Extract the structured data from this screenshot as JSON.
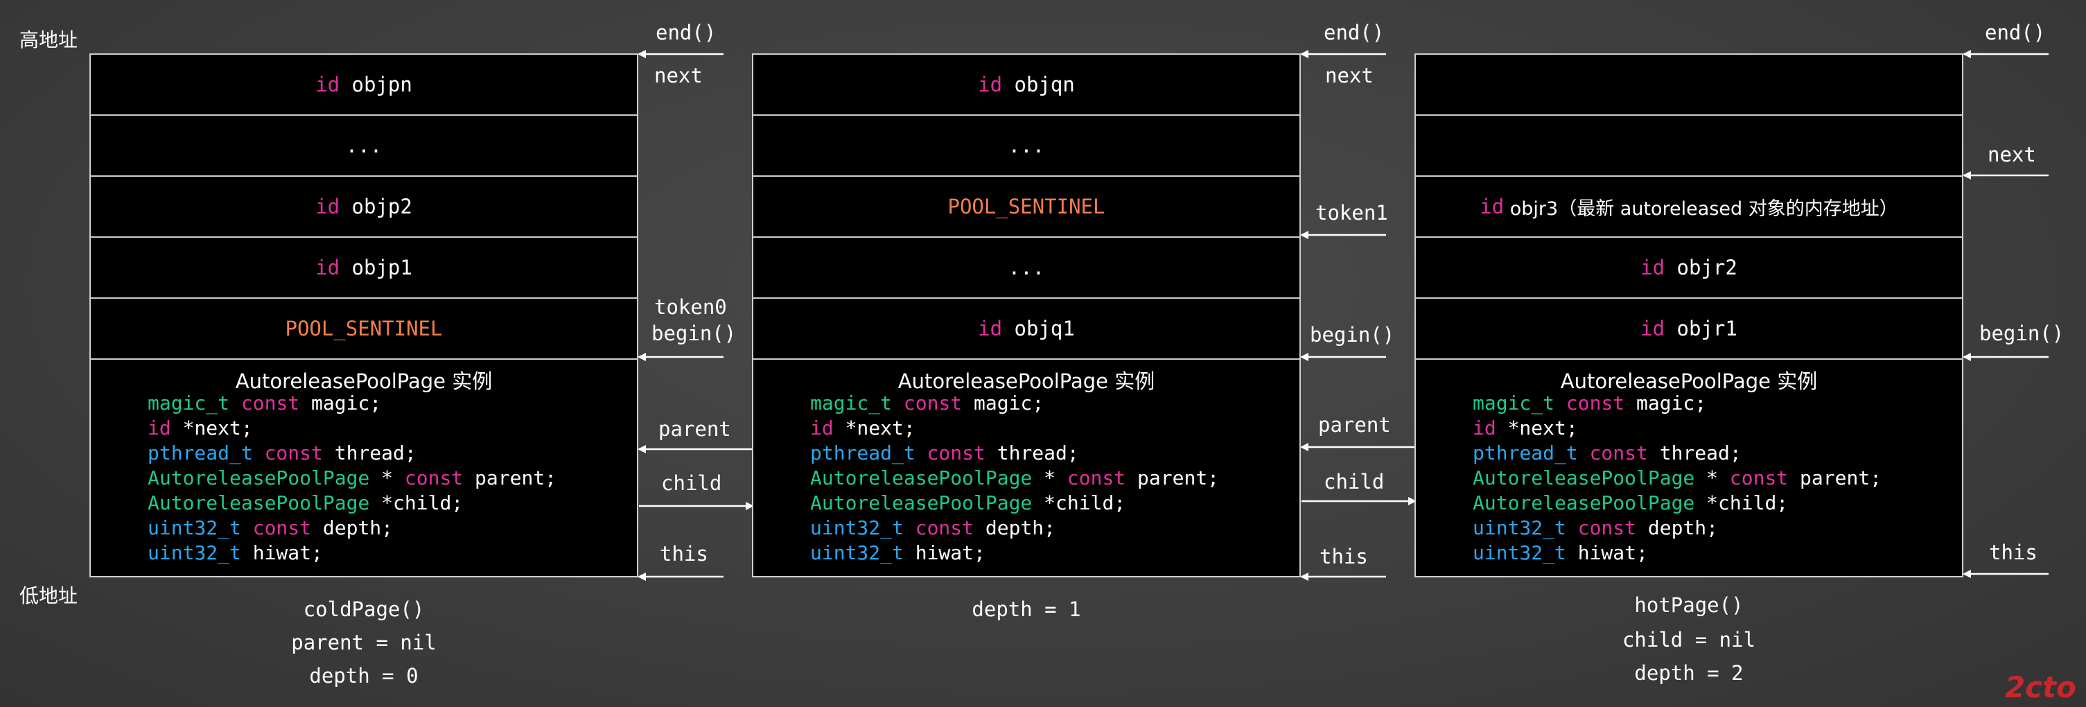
{
  "address_high": "高地址",
  "address_low": "低地址",
  "id_kw": "id",
  "pages": [
    {
      "slots": [
        {
          "kw": "id",
          "text": " objpn"
        },
        {
          "text": "..."
        },
        {
          "kw": "id",
          "text": " objp2"
        },
        {
          "kw": "id",
          "text": " objp1"
        },
        {
          "sentinel": "POOL_SENTINEL"
        }
      ],
      "captions": [
        "coldPage()",
        "parent = nil",
        "depth = 0"
      ]
    },
    {
      "slots": [
        {
          "kw": "id",
          "text": " objqn"
        },
        {
          "text": "..."
        },
        {
          "sentinel": "POOL_SENTINEL"
        },
        {
          "text": "..."
        },
        {
          "kw": "id",
          "text": " objq1"
        }
      ],
      "captions": [
        "depth = 1"
      ]
    },
    {
      "slots": [
        {
          "text": ""
        },
        {
          "text": ""
        },
        {
          "kw": "id",
          "text": " objr3（最新 autoreleased 对象的内存地址）"
        },
        {
          "kw": "id",
          "text": " objr2"
        },
        {
          "kw": "id",
          "text": " objr1"
        }
      ],
      "captions": [
        "hotPage()",
        "child = nil",
        "depth = 2"
      ]
    }
  ],
  "struct": {
    "title": "AutoreleasePoolPage 实例",
    "fields": [
      {
        "t": "magic_t",
        "k": " const",
        "r": " magic;"
      },
      {
        "t": "",
        "k": "id",
        "r": " *next;"
      },
      {
        "t": "pthread_t",
        "k": " const",
        "r": " thread;"
      },
      {
        "t": "AutoreleasePoolPage",
        "k": "",
        "r": " * ",
        "k2": "const",
        "r2": " parent;"
      },
      {
        "t": "AutoreleasePoolPage",
        "k": "",
        "r": " *child;"
      },
      {
        "t": "uint32_t",
        "k": " const",
        "r": " depth;"
      },
      {
        "t": "uint32_t",
        "k": "",
        "r": " hiwat;"
      }
    ]
  },
  "labels": {
    "end": "end()",
    "next": "next",
    "token0": "token0",
    "token1": "token1",
    "begin": "begin()",
    "parent": "parent",
    "child": "child",
    "this": "this"
  },
  "watermark": "2cto",
  "colors": {
    "keyword": "#e0309a",
    "type": "#1ec98b",
    "type_alt": "#2aa6f0",
    "sentinel": "#f07f4a"
  }
}
